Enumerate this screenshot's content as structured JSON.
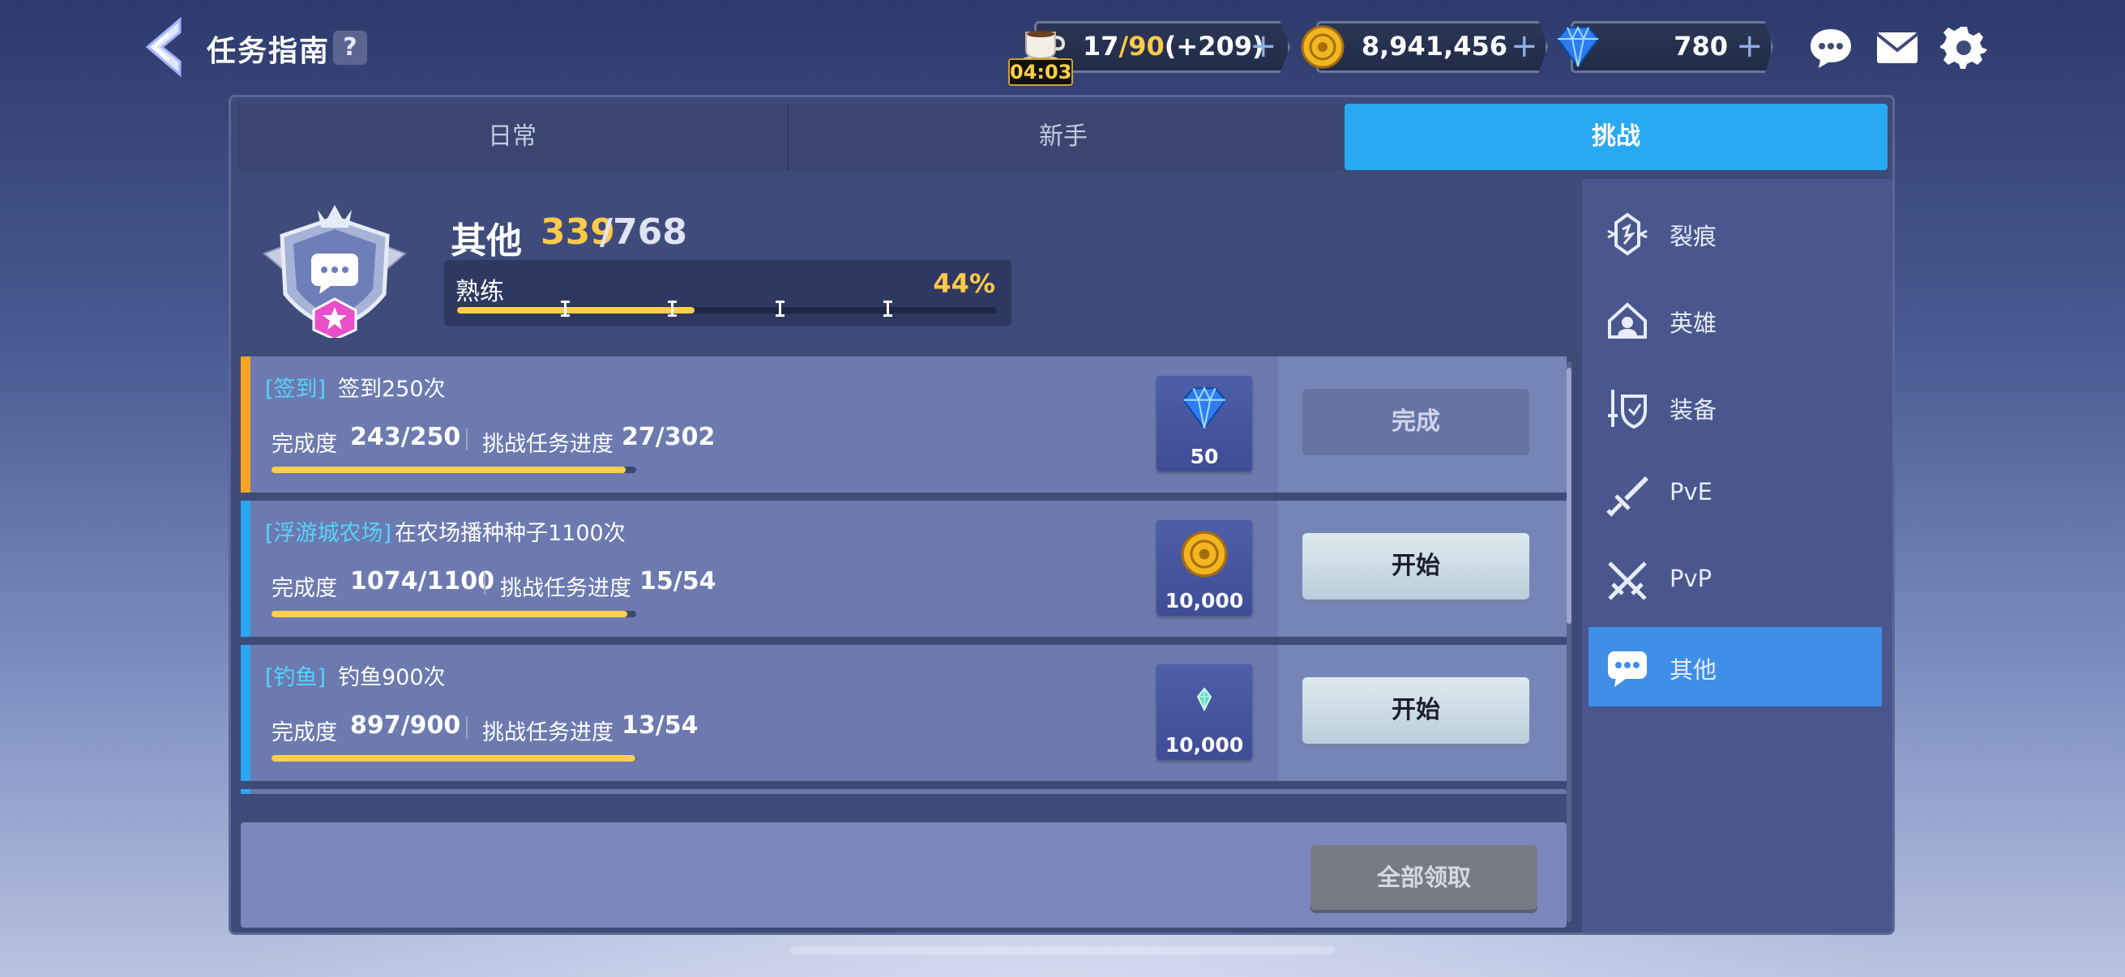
{
  "header": {
    "title": "任务指南",
    "help": "?"
  },
  "resources": {
    "stamina": {
      "current": "17",
      "max": "/90",
      "bonus": "(+209)",
      "timer": "04:03"
    },
    "gold": {
      "value": "8,941,456"
    },
    "gems": {
      "value": "780"
    },
    "plus": "+"
  },
  "tabs": [
    {
      "label": "日常",
      "active": false
    },
    {
      "label": "新手",
      "active": false
    },
    {
      "label": "挑战",
      "active": true
    }
  ],
  "category": {
    "name": "其他",
    "current": "339",
    "max": "/768",
    "proficiency_label": "熟练",
    "proficiency_pct": "44%",
    "progress": 0.44
  },
  "tasks": [
    {
      "tag": "[签到]",
      "desc": "签到250次",
      "completion_label": "完成度",
      "completion_value": "243/250",
      "challenge_label": "挑战任务进度",
      "challenge_value": "27/302",
      "progress": 0.972,
      "reward_type": "gem",
      "reward_amount": "50",
      "button": "完成",
      "button_state": "done",
      "stripe_color": "#f5a623"
    },
    {
      "tag": "[浮游城农场]",
      "desc": "在农场播种种子1100次",
      "completion_label": "完成度",
      "completion_value": "1074/1100",
      "challenge_label": "挑战任务进度",
      "challenge_value": "15/54",
      "progress": 0.976,
      "reward_type": "gold",
      "reward_amount": "10,000",
      "button": "开始",
      "button_state": "start",
      "stripe_color": "#2ea6f0"
    },
    {
      "tag": "[钓鱼]",
      "desc": "钓鱼900次",
      "completion_label": "完成度",
      "completion_value": "897/900",
      "challenge_label": "挑战任务进度",
      "challenge_value": "13/54",
      "progress": 0.997,
      "reward_type": "crystal",
      "reward_amount": "10,000",
      "button": "开始",
      "button_state": "start",
      "stripe_color": "#2ea6f0"
    }
  ],
  "claim_all": "全部领取",
  "side_menu": [
    {
      "label": "裂痕",
      "icon": "rift-icon",
      "active": false
    },
    {
      "label": "英雄",
      "icon": "hero-icon",
      "active": false
    },
    {
      "label": "装备",
      "icon": "equipment-icon",
      "active": false
    },
    {
      "label": "PvE",
      "icon": "sword-icon",
      "active": false
    },
    {
      "label": "PvP",
      "icon": "crossed-swords-icon",
      "active": false
    },
    {
      "label": "其他",
      "icon": "chat-bubble-icon",
      "active": true
    }
  ],
  "colors": {
    "accent": "#29a9f2",
    "gold": "#ffc94a",
    "tag": "#56d3ff"
  }
}
